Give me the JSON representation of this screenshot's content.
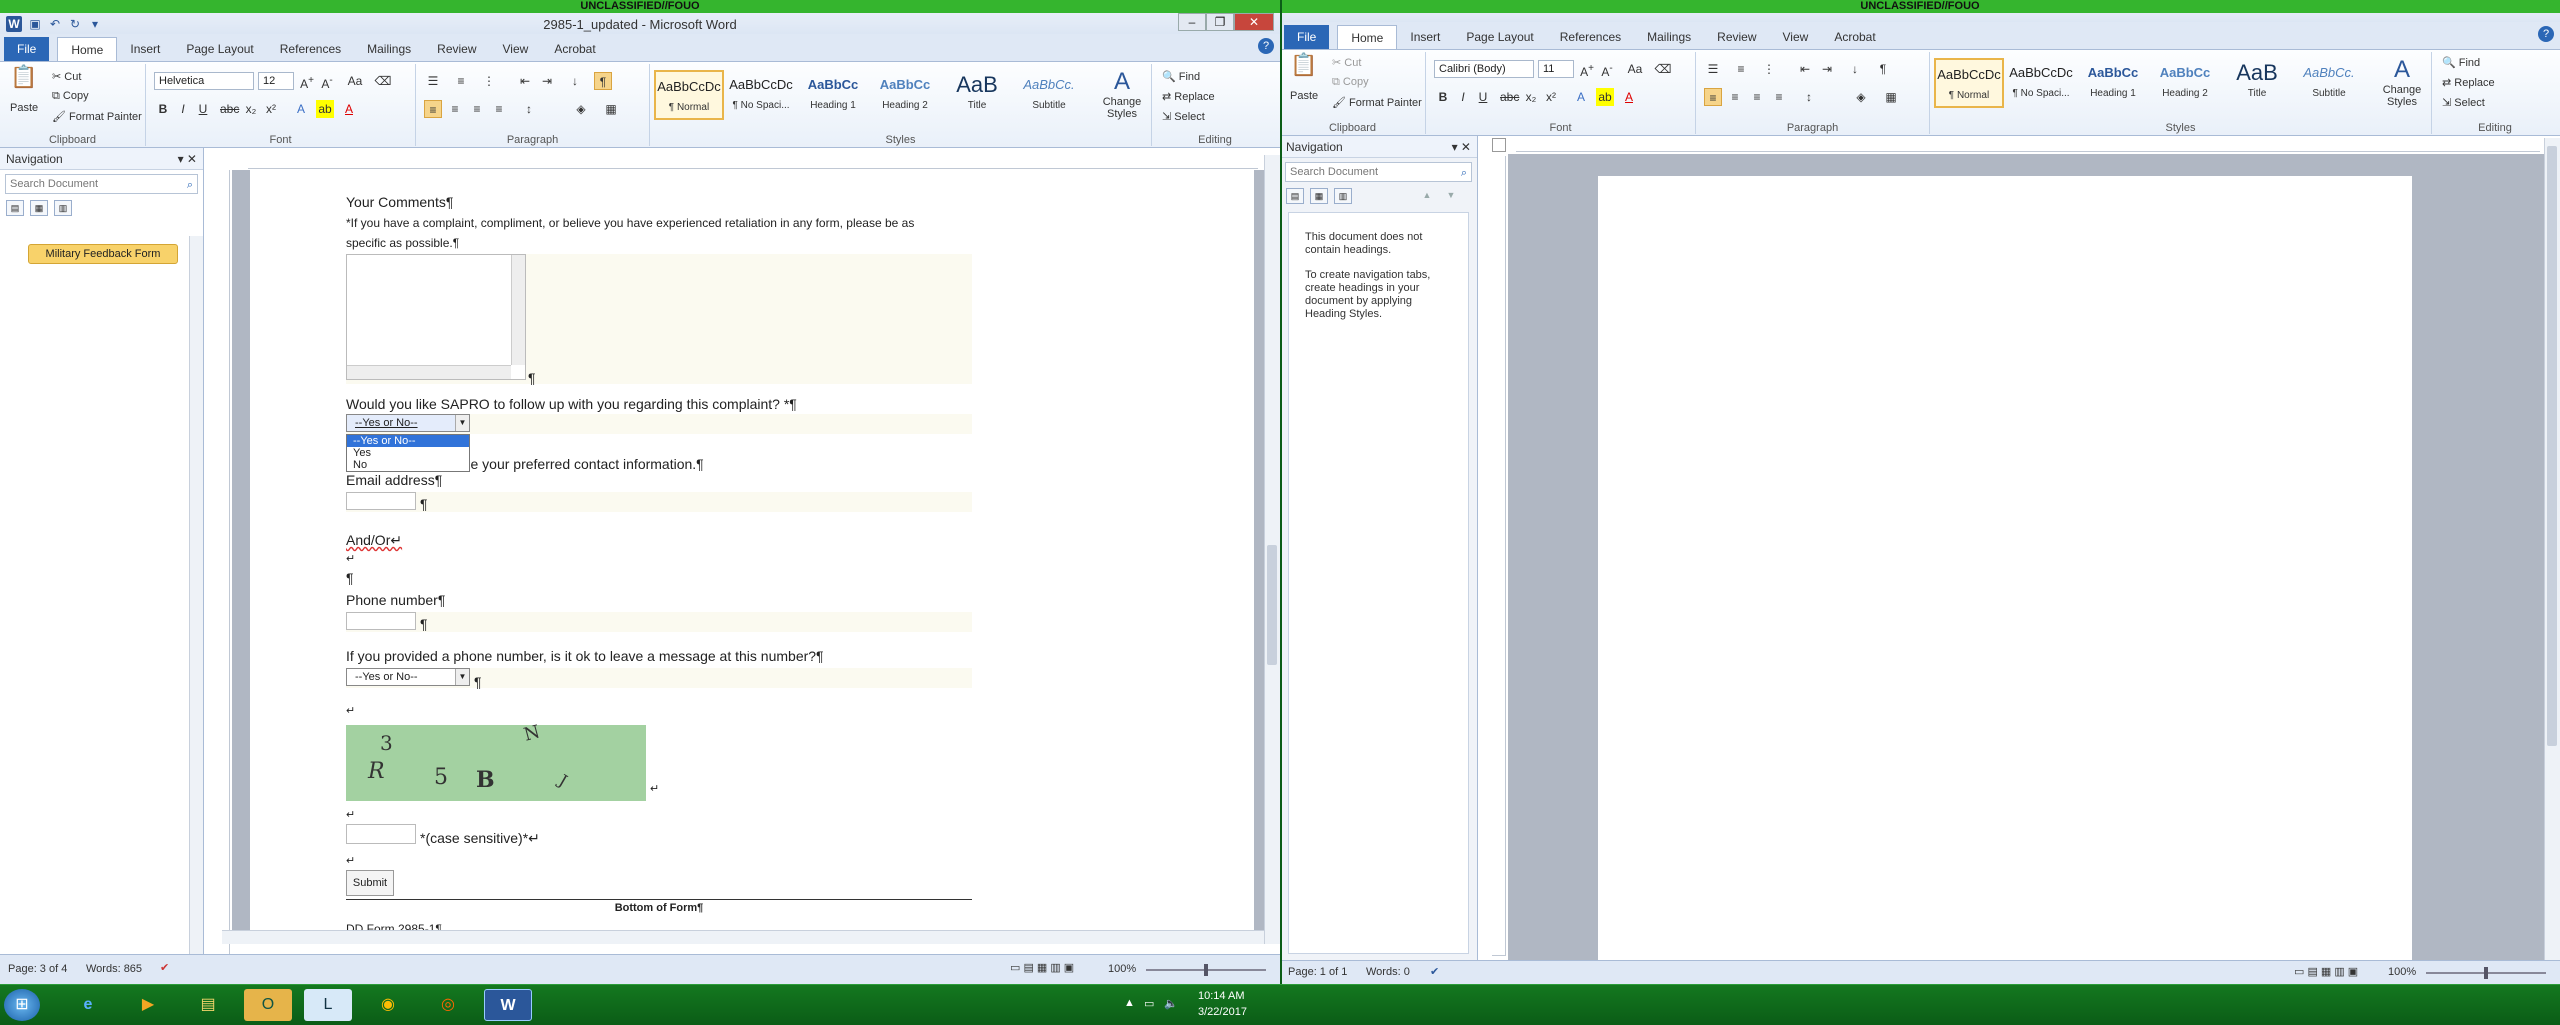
{
  "left_window": {
    "classification": "UNCLASSIFIED//FOUO",
    "title": "2985-1_updated - Microsoft Word",
    "tabs": [
      "File",
      "Home",
      "Insert",
      "Page Layout",
      "References",
      "Mailings",
      "Review",
      "View",
      "Acrobat"
    ],
    "ribbon": {
      "clipboard": {
        "paste": "Paste",
        "cut": "Cut",
        "copy": "Copy",
        "format_painter": "Format Painter",
        "label": "Clipboard"
      },
      "font": {
        "name": "Helvetica",
        "size": "12",
        "label": "Font"
      },
      "paragraph": {
        "label": "Paragraph"
      },
      "styles": {
        "items": [
          {
            "sample": "AaBbCcDc",
            "name": "¶ Normal"
          },
          {
            "sample": "AaBbCcDc",
            "name": "¶ No Spaci..."
          },
          {
            "sample": "AaBbCc",
            "name": "Heading 1"
          },
          {
            "sample": "AaBbCc",
            "name": "Heading 2"
          },
          {
            "sample": "AaB",
            "name": "Title"
          },
          {
            "sample": "AaBbCc.",
            "name": "Subtitle"
          }
        ],
        "change_styles": "Change Styles",
        "label": "Styles"
      },
      "editing": {
        "find": "Find",
        "replace": "Replace",
        "select": "Select",
        "label": "Editing"
      }
    },
    "nav": {
      "title": "Navigation",
      "search_placeholder": "Search Document",
      "result": "Military Feedback Form"
    },
    "document": {
      "your_comments": "Your Comments¶",
      "instruction_line1": "*If you have a complaint, compliment, or believe you have experienced retaliation in any form, please be as",
      "instruction_line2": "specific as possible.¶",
      "pilcrow": "¶",
      "followup_question": "Would you like SAPRO to follow up with you regarding this complaint? *¶",
      "select_value": "--Yes or No--",
      "dropdown_options": [
        "--Yes or No--",
        "Yes",
        "No"
      ],
      "contact_info": "If yes, please provide your preferred contact information.¶",
      "email_label": "Email address¶",
      "and_or": "And/Or↵",
      "return_mark": "↵",
      "phone_label": "Phone number¶",
      "message_question": "If you provided a phone number, is it ok to leave a message at this number?¶",
      "captcha_chars": [
        "3",
        "N",
        "R",
        "5",
        "B",
        "J"
      ],
      "case_sensitive": "*(case sensitive)*↵",
      "submit": "Submit",
      "bottom_of_form": "Bottom of Form¶",
      "dd_form": "DD Form 2985-1¶"
    },
    "status": {
      "page": "Page: 3 of 4",
      "words": "Words: 865",
      "zoom": "100%"
    }
  },
  "right_window": {
    "classification": "UNCLASSIFIED//FOUO",
    "tabs": [
      "File",
      "Home",
      "Insert",
      "Page Layout",
      "References",
      "Mailings",
      "Review",
      "View",
      "Acrobat"
    ],
    "ribbon": {
      "clipboard": {
        "paste": "Paste",
        "cut": "Cut",
        "copy": "Copy",
        "format_painter": "Format Painter",
        "label": "Clipboard"
      },
      "font": {
        "name": "Calibri (Body)",
        "size": "11",
        "label": "Font"
      },
      "paragraph": {
        "label": "Paragraph"
      },
      "styles": {
        "items": [
          {
            "sample": "AaBbCcDc",
            "name": "¶ Normal"
          },
          {
            "sample": "AaBbCcDc",
            "name": "¶ No Spaci..."
          },
          {
            "sample": "AaBbCc",
            "name": "Heading 1"
          },
          {
            "sample": "AaBbCc",
            "name": "Heading 2"
          },
          {
            "sample": "AaB",
            "name": "Title"
          },
          {
            "sample": "AaBbCc.",
            "name": "Subtitle"
          }
        ],
        "change_styles": "Change Styles",
        "label": "Styles"
      },
      "editing": {
        "find": "Find",
        "replace": "Replace",
        "select": "Select",
        "label": "Editing"
      }
    },
    "nav": {
      "title": "Navigation",
      "search_placeholder": "Search Document",
      "msg1": "This document does not contain headings.",
      "msg2": "To create navigation tabs, create headings in your document by applying Heading Styles."
    },
    "status": {
      "page": "Page: 1 of 1",
      "words": "Words: 0",
      "zoom": "100%"
    }
  },
  "taskbar": {
    "time": "10:14 AM",
    "date": "3/22/2017"
  },
  "colors": {
    "classification_bar": "#35b52e",
    "taskbar": "#0b5d17",
    "captcha_bg": "#a3d1a1",
    "nav_result": "#f8d26a"
  }
}
